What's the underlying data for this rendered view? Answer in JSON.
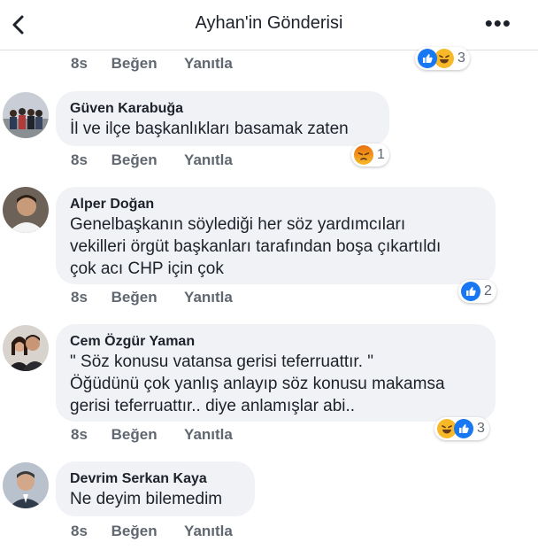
{
  "header": {
    "title": "Ayhan'in Gönderisi"
  },
  "actions": {
    "like": "Beğen",
    "reply": "Yanıtla"
  },
  "comments": [
    {
      "time": "8s",
      "reactions": {
        "icons": [
          "like",
          "haha"
        ],
        "count": "3"
      }
    },
    {
      "author": "Güven Karabuğa",
      "lines": [
        "İl ve ilçe başkanlıkları basamak zaten"
      ],
      "time": "8s",
      "reactions": {
        "icons": [
          "angry"
        ],
        "count": "1"
      }
    },
    {
      "author": "Alper Doğan",
      "lines": [
        "Genelbaşkanın söylediği her söz yardımcıları",
        "vekilleri örgüt başkanları tarafından boşa çıkartıldı",
        "çok acı CHP için çok"
      ],
      "time": "8s",
      "reactions": {
        "icons": [
          "like"
        ],
        "count": "2"
      }
    },
    {
      "author": "Cem Özgür Yaman",
      "lines": [
        "\" Söz konusu vatansa gerisi teferruattır. \"",
        "Öğüdünü çok yanlış anlayıp söz konusu makamsa",
        "gerisi teferruattır.. diye anlamışlar abi.."
      ],
      "time": "8s",
      "reactions": {
        "icons": [
          "haha",
          "like"
        ],
        "count": "3"
      }
    },
    {
      "author": "Devrim Serkan Kaya",
      "lines": [
        "Ne deyim bilemedim"
      ],
      "time": "8s"
    }
  ],
  "colors": {
    "like": "#1877f2",
    "haha": "#f7b928",
    "angry": "#e9710f",
    "bubble": "#f0f2f5"
  }
}
